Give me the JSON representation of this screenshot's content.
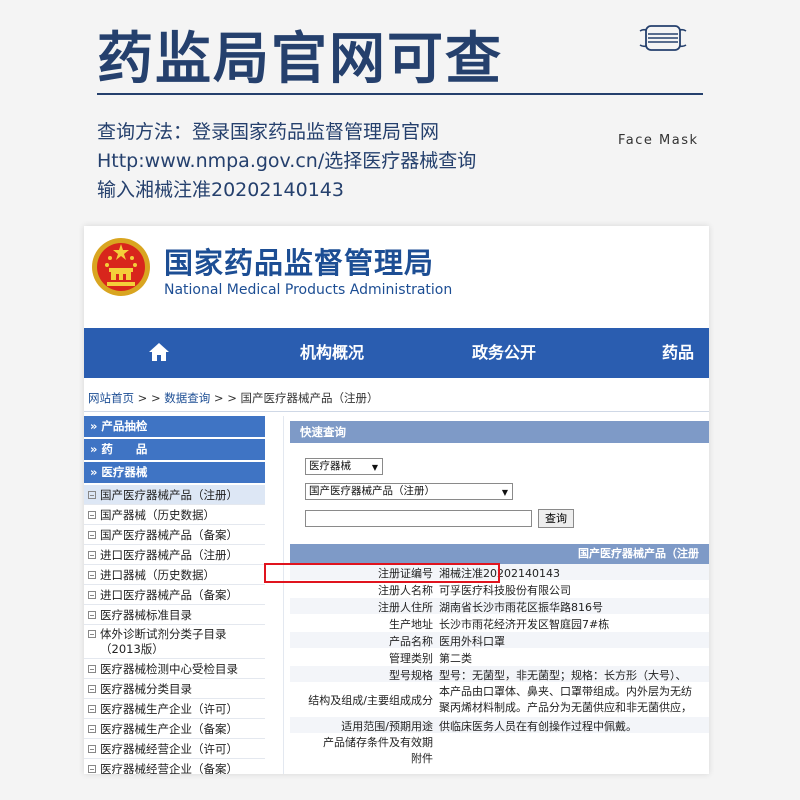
{
  "poster": {
    "title": "药监局官网可查",
    "instruction_lines": [
      "查询方法：登录国家药品监督管理局官网",
      "Http:www.nmpa.gov.cn/选择医疗器械查询",
      "输入湘械注准20202140143"
    ],
    "face_mask_label": "Face Mask",
    "icon": "face-mask-icon"
  },
  "site": {
    "name_cn": "国家药品监督管理局",
    "name_en": "National Medical Products Administration",
    "emblem_icon": "national-emblem-icon"
  },
  "nav": {
    "home_icon": "home-icon",
    "items": [
      "机构概况",
      "政务公开",
      "药品"
    ]
  },
  "breadcrumb": {
    "home": "网站首页",
    "query": "数据查询",
    "current": "国产医疗器械产品（注册）",
    "sep": " > > "
  },
  "sidebar": {
    "headers": [
      "» 产品抽检",
      "» 药　　品",
      "» 医疗器械"
    ],
    "items": [
      "国产医疗器械产品（注册）",
      "国产器械（历史数据）",
      "国产医疗器械产品（备案）",
      "进口医疗器械产品（注册）",
      "进口器械（历史数据）",
      "进口医疗器械产品（备案）",
      "医疗器械标准目录",
      "体外诊断试剂分类子目录（2013版）",
      "医疗器械检测中心受检目录",
      "医疗器械分类目录",
      "医疗器械生产企业（许可）",
      "医疗器械生产企业（备案）",
      "医疗器械经营企业（许可）",
      "医疗器械经营企业（备案）"
    ]
  },
  "quick_query": {
    "title": "快速查询",
    "select1": "医疗器械",
    "select2": "国产医疗器械产品（注册）",
    "input_value": "",
    "button": "查询"
  },
  "result": {
    "header": "国产医疗器械产品（注册",
    "rows": [
      {
        "label": "注册证编号",
        "value": "湘械注准20202140143"
      },
      {
        "label": "注册人名称",
        "value": "可孚医疗科技股份有限公司"
      },
      {
        "label": "注册人住所",
        "value": "湖南省长沙市雨花区振华路816号"
      },
      {
        "label": "生产地址",
        "value": "长沙市雨花经济开发区智庭园7#栋"
      },
      {
        "label": "产品名称",
        "value": "医用外科口罩"
      },
      {
        "label": "管理类别",
        "value": "第二类"
      },
      {
        "label": "型号规格",
        "value": "型号：无菌型，非无菌型；规格：长方形（大号）、"
      },
      {
        "label": "结构及组成/主要组成成分",
        "value": "本产品由口罩体、鼻夹、口罩带组成。内外层为无纺",
        "value2": "聚丙烯材料制成。产品分为无菌供应和非无菌供应，"
      },
      {
        "label": "适用范围/预期用途",
        "value": "供临床医务人员在有创操作过程中佩戴。"
      },
      {
        "label": "产品储存条件及有效期",
        "label2": "附件",
        "value": ""
      }
    ]
  },
  "colors": {
    "poster_navy": "#25406d",
    "nav_blue": "#2a5db0",
    "sidebar_blue": "#3f74c4",
    "panel_blue": "#7e9ac7",
    "highlight_red": "#e0141e"
  }
}
